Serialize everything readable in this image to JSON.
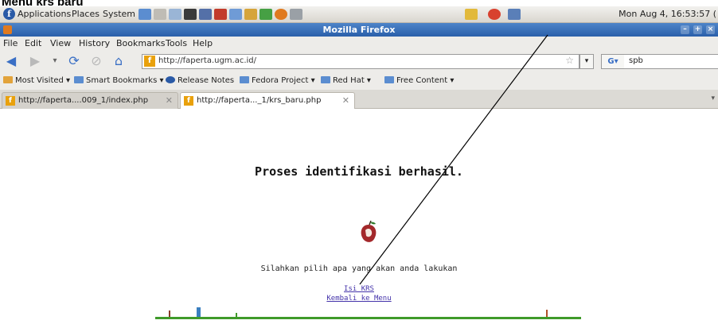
{
  "caption": "Menu krs baru",
  "panel": {
    "menus": [
      "Applications",
      "Places",
      "System"
    ],
    "clock": "Mon Aug  4, 16:53:57 ("
  },
  "window": {
    "title": "Mozilla Firefox"
  },
  "menubar": [
    "File",
    "Edit",
    "View",
    "History",
    "Bookmarks",
    "Tools",
    "Help"
  ],
  "navigation": {
    "url": "http://faperta.ugm.ac.id/",
    "search_value": "spb",
    "search_engine_label": "G"
  },
  "bookmarks": [
    "Most Visited",
    "Smart Bookmarks",
    "Release Notes",
    "Fedora Project",
    "Red Hat",
    "Free Content"
  ],
  "tabs": [
    {
      "label": "http://faperta....009_1/index.php",
      "active": false
    },
    {
      "label": "http://faperta..._1/krs_baru.php",
      "active": true
    }
  ],
  "page": {
    "success_message": "Proses identifikasi berhasil.",
    "instruction": "Silahkan pilih apa yang akan anda lakukan",
    "links": {
      "isi_krs": "Isi KRS",
      "kembali": "Kembali ke Menu"
    }
  },
  "colors": {
    "titlebar": "#2a5fa9",
    "link": "#4433aa",
    "ground": "#3f9a2a"
  }
}
